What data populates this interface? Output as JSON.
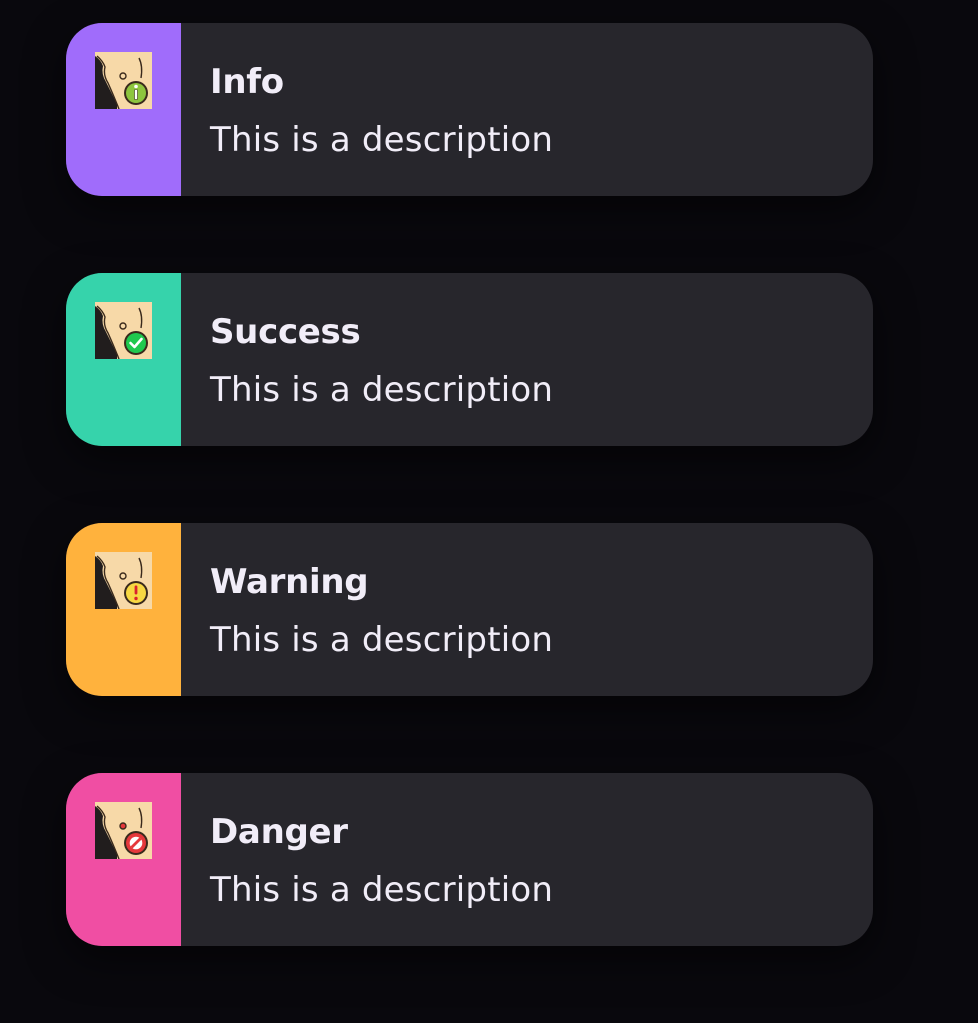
{
  "toasts": [
    {
      "title": "Info",
      "description": "This is a description",
      "accent_color": "#a06cfb",
      "badge_color": "#8dc53e",
      "icon": "info-icon"
    },
    {
      "title": "Success",
      "description": "This is a description",
      "accent_color": "#36d3ab",
      "badge_color": "#1fc94e",
      "icon": "check-icon"
    },
    {
      "title": "Warning",
      "description": "This is a description",
      "accent_color": "#ffb23d",
      "badge_color": "#f7d842",
      "icon": "exclamation-icon"
    },
    {
      "title": "Danger",
      "description": "This is a description",
      "accent_color": "#f04ea3",
      "badge_color": "#e5383b",
      "icon": "prohibited-icon"
    }
  ]
}
